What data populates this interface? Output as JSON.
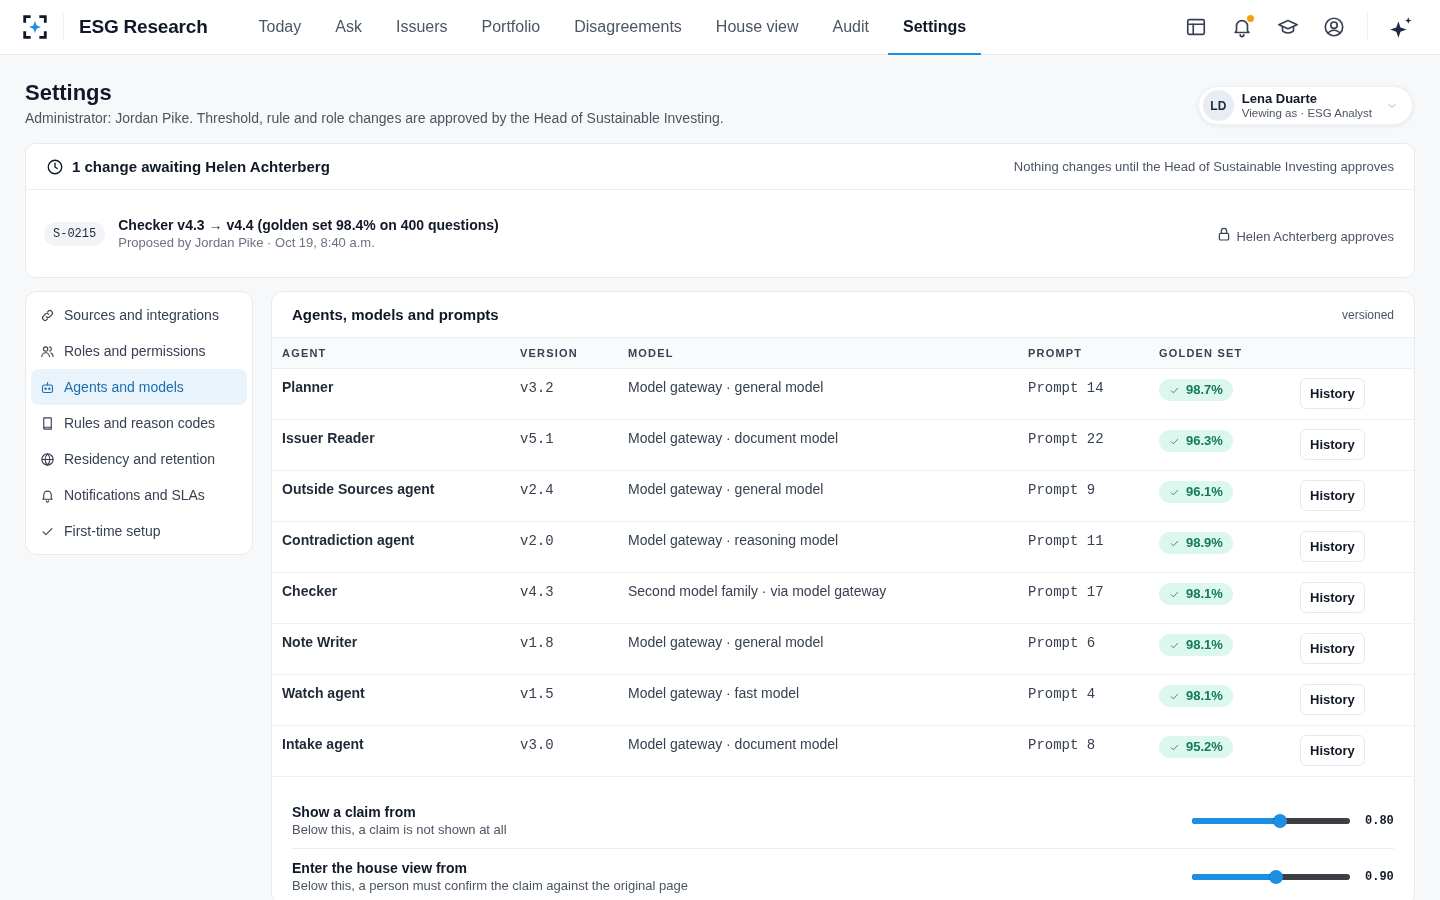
{
  "app": {
    "name": "ESG Research"
  },
  "nav": [
    {
      "label": "Today",
      "selected": false
    },
    {
      "label": "Ask",
      "selected": false
    },
    {
      "label": "Issuers",
      "selected": false
    },
    {
      "label": "Portfolio",
      "selected": false
    },
    {
      "label": "Disagreements",
      "selected": false
    },
    {
      "label": "House view",
      "selected": false
    },
    {
      "label": "Audit",
      "selected": false
    },
    {
      "label": "Settings",
      "selected": true
    }
  ],
  "notifications": {
    "unread": true
  },
  "page": {
    "title": "Settings",
    "subtitle": "Administrator: Jordan Pike. Threshold, rule and role changes are approved by the Head of Sustainable Investing."
  },
  "user": {
    "initials": "LD",
    "name": "Lena Duarte",
    "role": "Viewing as · ESG Analyst"
  },
  "pending": {
    "title": "1 change awaiting Helen Achterberg",
    "note": "Nothing changes until the Head of Sustainable Investing approves",
    "changes": [
      {
        "id": "S-0215",
        "title": "Checker v4.3 → v4.4 (golden set 98.4% on 400 questions)",
        "meta": "Proposed by Jordan Pike · Oct 19, 8:40 a.m.",
        "approver": "Helen Achterberg approves"
      }
    ]
  },
  "sidebar": {
    "items": [
      {
        "label": "Sources and integrations",
        "selected": false
      },
      {
        "label": "Roles and permissions",
        "selected": false
      },
      {
        "label": "Agents and models",
        "selected": true
      },
      {
        "label": "Rules and reason codes",
        "selected": false
      },
      {
        "label": "Residency and retention",
        "selected": false
      },
      {
        "label": "Notifications and SLAs",
        "selected": false
      },
      {
        "label": "First-time setup",
        "selected": false
      }
    ]
  },
  "panel": {
    "title": "Agents, models and prompts",
    "tag": "versioned",
    "table": {
      "columns": [
        "AGENT",
        "VERSION",
        "MODEL",
        "PROMPT",
        "GOLDEN SET"
      ],
      "rows": [
        {
          "agent": "Planner",
          "version": "v3.2",
          "model": "Model gateway · general model",
          "prompt": "Prompt 14",
          "golden_set": "98.7%",
          "passed": true,
          "action": "History"
        },
        {
          "agent": "Issuer Reader",
          "version": "v5.1",
          "model": "Model gateway · document model",
          "prompt": "Prompt 22",
          "golden_set": "96.3%",
          "passed": true,
          "action": "History"
        },
        {
          "agent": "Outside Sources agent",
          "version": "v2.4",
          "model": "Model gateway · general model",
          "prompt": "Prompt 9",
          "golden_set": "96.1%",
          "passed": true,
          "action": "History"
        },
        {
          "agent": "Contradiction agent",
          "version": "v2.0",
          "model": "Model gateway · reasoning model",
          "prompt": "Prompt 11",
          "golden_set": "98.9%",
          "passed": true,
          "action": "History"
        },
        {
          "agent": "Checker",
          "version": "v4.3",
          "model": "Second model family · via model gateway",
          "prompt": "Prompt 17",
          "golden_set": "98.1%",
          "passed": true,
          "action": "History"
        },
        {
          "agent": "Note Writer",
          "version": "v1.8",
          "model": "Model gateway · general model",
          "prompt": "Prompt 6",
          "golden_set": "98.1%",
          "passed": true,
          "action": "History"
        },
        {
          "agent": "Watch agent",
          "version": "v1.5",
          "model": "Model gateway · fast model",
          "prompt": "Prompt 4",
          "golden_set": "98.1%",
          "passed": true,
          "action": "History"
        },
        {
          "agent": "Intake agent",
          "version": "v3.0",
          "model": "Model gateway · document model",
          "prompt": "Prompt 8",
          "golden_set": "95.2%",
          "passed": true,
          "action": "History"
        }
      ]
    },
    "thresholds": [
      {
        "label": "Show a claim from",
        "description": "Below this, a claim is not shown at all",
        "level": 0.56,
        "reading": "0.80"
      },
      {
        "label": "Enter the house view from",
        "description": "Below this, a person must confirm the claim against the original page",
        "level": 0.53,
        "reading": "0.90"
      }
    ]
  }
}
